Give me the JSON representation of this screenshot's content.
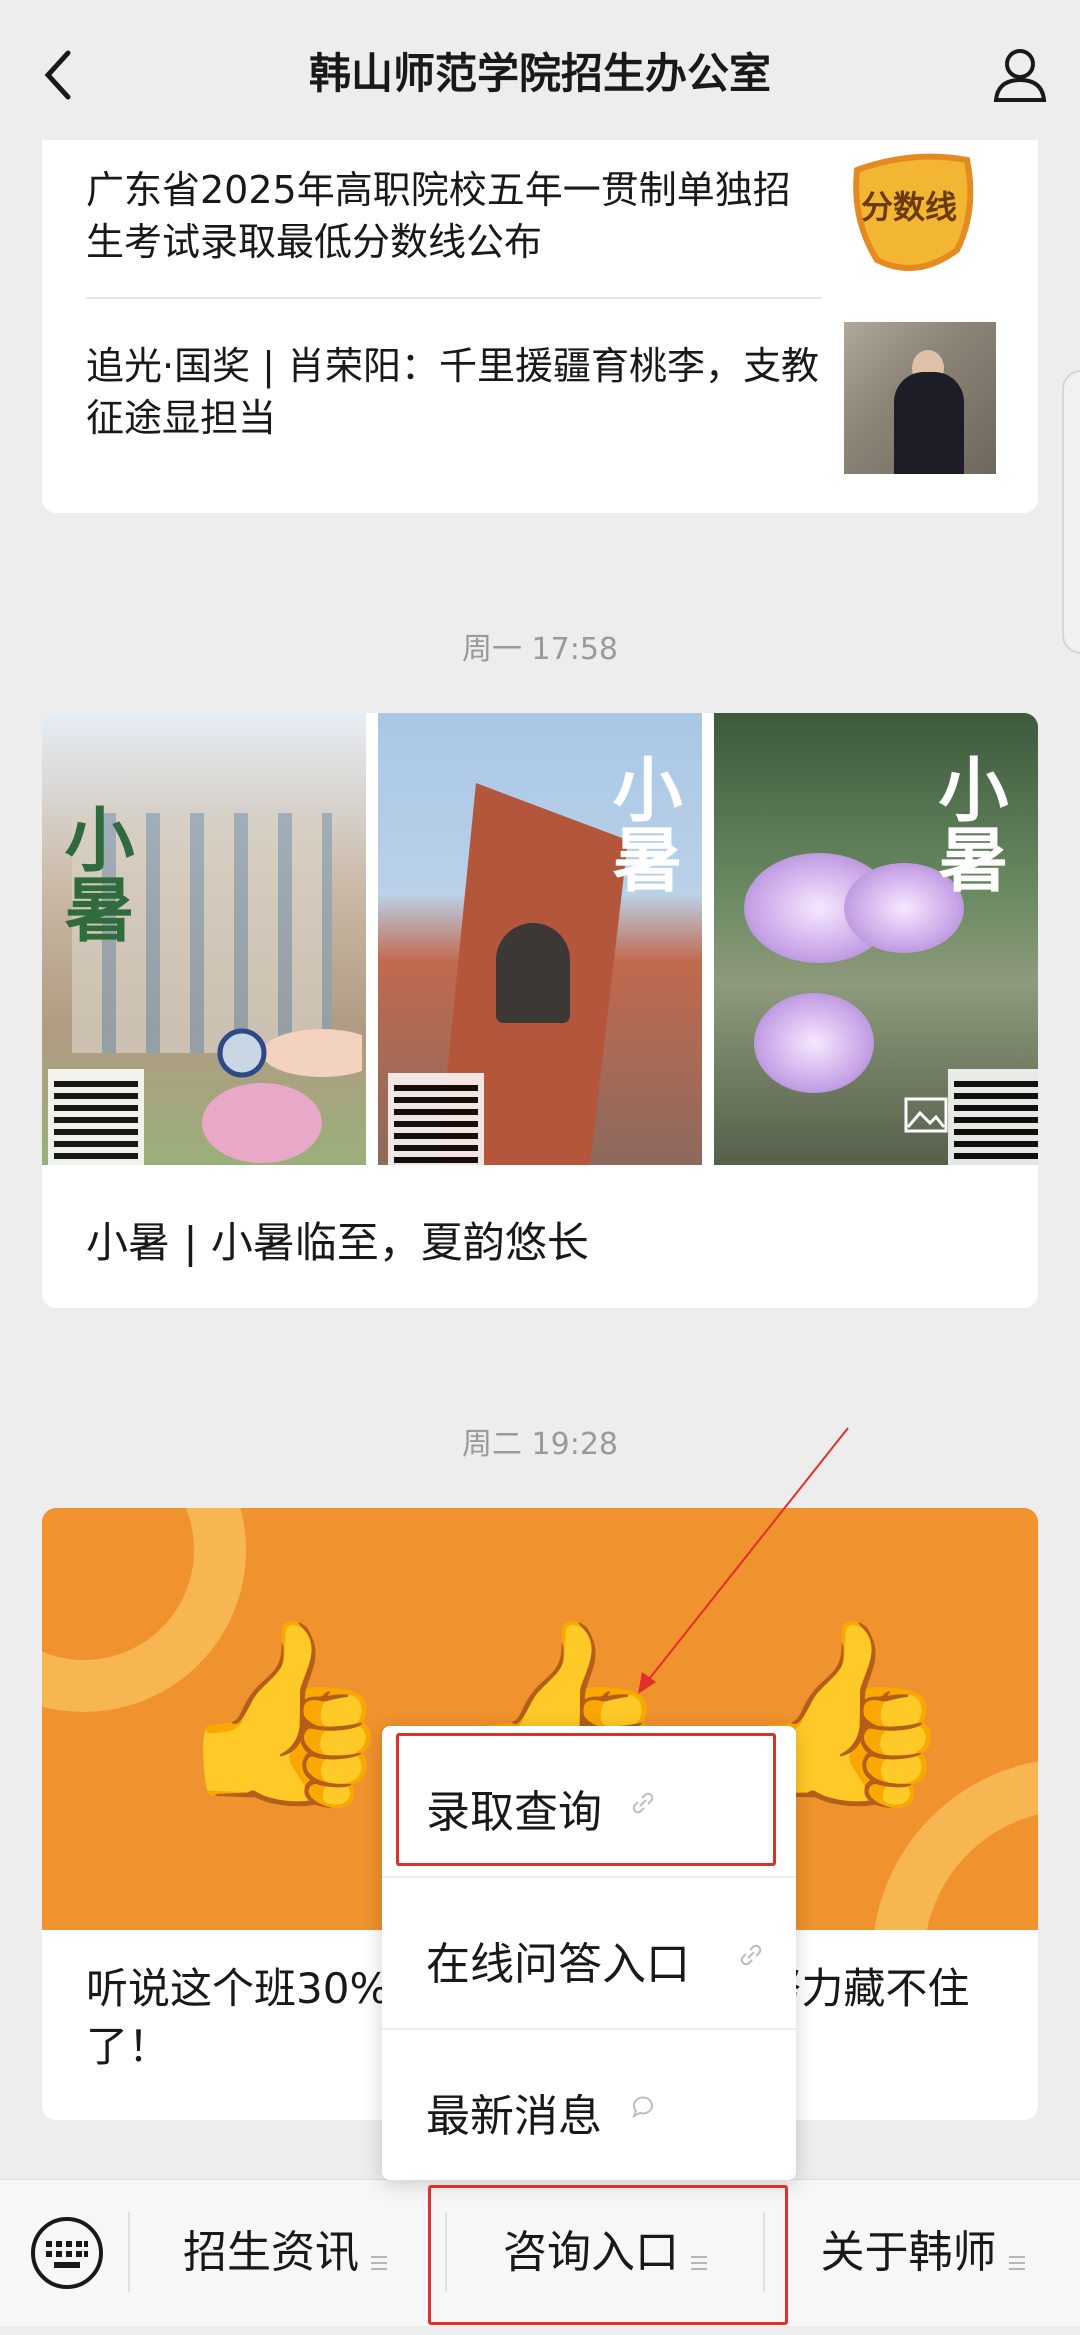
{
  "header": {
    "title": "韩山师范学院招生办公室"
  },
  "articles": [
    {
      "title": "广东省2025年高职院校五年一贯制单独招生考试录取最低分数线公布",
      "thumb_text": "分数线"
    },
    {
      "title": "追光·国奖 | 肖荣阳：千里援疆育桃李，支教征途显担当"
    }
  ],
  "timestamps": [
    "周一 17:58",
    "周二 19:28"
  ],
  "posters": [
    {
      "calligraphy": "小暑",
      "header": "韩山师范学院招生办公室"
    },
    {
      "calligraphy": "小暑",
      "side": "农历六月十三",
      "date": "2025/07/07"
    },
    {
      "calligraphy": "小暑",
      "date": "2025/7/7",
      "side": "农历六月十三"
    }
  ],
  "post2_caption": "小暑 | 小暑临至，夏韵悠长",
  "post3_caption": "听说这个班30%...努力藏不住了！",
  "post3_caption_left": "听说这个班30%",
  "post3_caption_right": "努力藏不住",
  "post3_caption_line2": "了！",
  "popup_menu": [
    {
      "label": "录取查询",
      "icon": "link-icon"
    },
    {
      "label": "在线问答入口",
      "icon": "link-icon"
    },
    {
      "label": "最新消息",
      "icon": "chat-bubble-icon"
    }
  ],
  "bottom_menu": [
    {
      "label": "招生资讯"
    },
    {
      "label": "咨询入口"
    },
    {
      "label": "关于韩师"
    }
  ],
  "colors": {
    "highlight": "#e0302a",
    "banner": "#f0922d"
  }
}
